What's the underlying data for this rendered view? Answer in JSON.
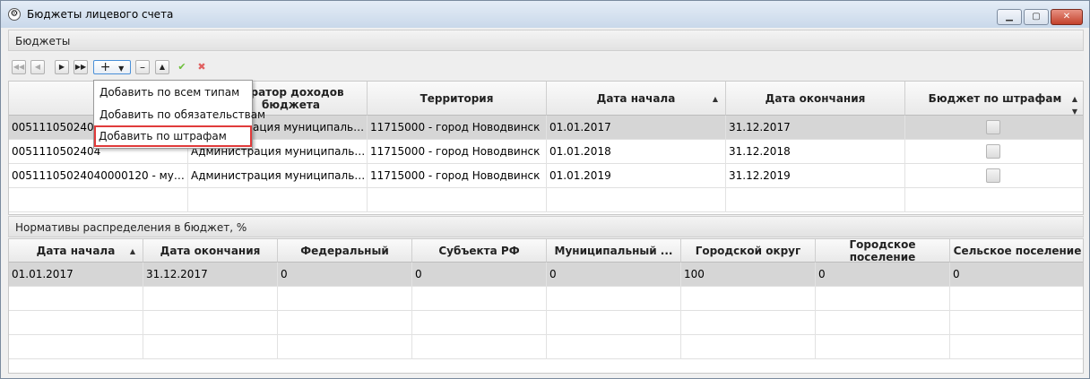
{
  "window": {
    "title": "Бюджеты лицевого счета",
    "icon": "app-icon",
    "controls": [
      "minimize-icon",
      "maximize-icon",
      "close-icon"
    ]
  },
  "budgets_section": {
    "title": "Бюджеты"
  },
  "toolbar": {
    "first_icon": "first-page-icon",
    "prev_icon": "prev-page-icon",
    "next_icon": "next-page-icon",
    "last_icon": "last-page-icon",
    "add_label": "+",
    "remove_label": "–",
    "up_label": "▲",
    "save_label": "✔",
    "cancel_label": "✖"
  },
  "add_menu": {
    "items": [
      "Добавить по всем типам",
      "Добавить по обязательствам",
      "Добавить по штрафам"
    ]
  },
  "budgets_table": {
    "columns": [
      "КБК",
      "Администратор доходов бюджета",
      "Территория",
      "Дата начала",
      "Дата окончания",
      "Бюджет по штрафам"
    ],
    "header_visible": {
      "col0": "К",
      "col1": "стратор доходов\nбюджета",
      "col2": "Территория",
      "col3": "Дата начала",
      "col4": "Дата окончания",
      "col5": "Бюджет по штрафам"
    },
    "rows": [
      {
        "kbk": "00511105024040000120 - муници...",
        "kbk_visible": "0051110502404",
        "admin": "Администрация муниципального...",
        "admin_visible": "ация муниципального...",
        "territory": "11715000 - город Новодвинск",
        "start": "01.01.2017",
        "end": "31.12.2017",
        "fines_budget": false
      },
      {
        "kbk": "00511105024040000120 - муници...",
        "kbk_visible": "0051110502404",
        "kbk_visible_tail": "0000120 - муници...",
        "admin": "Администрация муниципального...",
        "admin_visible": "Администрация муниципального...",
        "territory": "11715000 - город Новодвинск",
        "start": "01.01.2018",
        "end": "31.12.2018",
        "fines_budget": false
      },
      {
        "kbk": "00511105024040000120 - муници...",
        "admin": "Администрация муниципального...",
        "territory": "11715000 - город Новодвинск",
        "start": "01.01.2019",
        "end": "31.12.2019",
        "fines_budget": false
      }
    ]
  },
  "norms_section": {
    "title": "Нормативы распределения в бюджет, %"
  },
  "norms_table": {
    "columns": [
      "Дата начала",
      "Дата окончания",
      "Федеральный",
      "Субъекта РФ",
      "Муниципальный ...",
      "Городской округ",
      "Городское поселение",
      "Сельское поселение"
    ],
    "rows": [
      [
        "01.01.2017",
        "31.12.2017",
        "0",
        "0",
        "0",
        "100",
        "0",
        "0"
      ]
    ]
  }
}
